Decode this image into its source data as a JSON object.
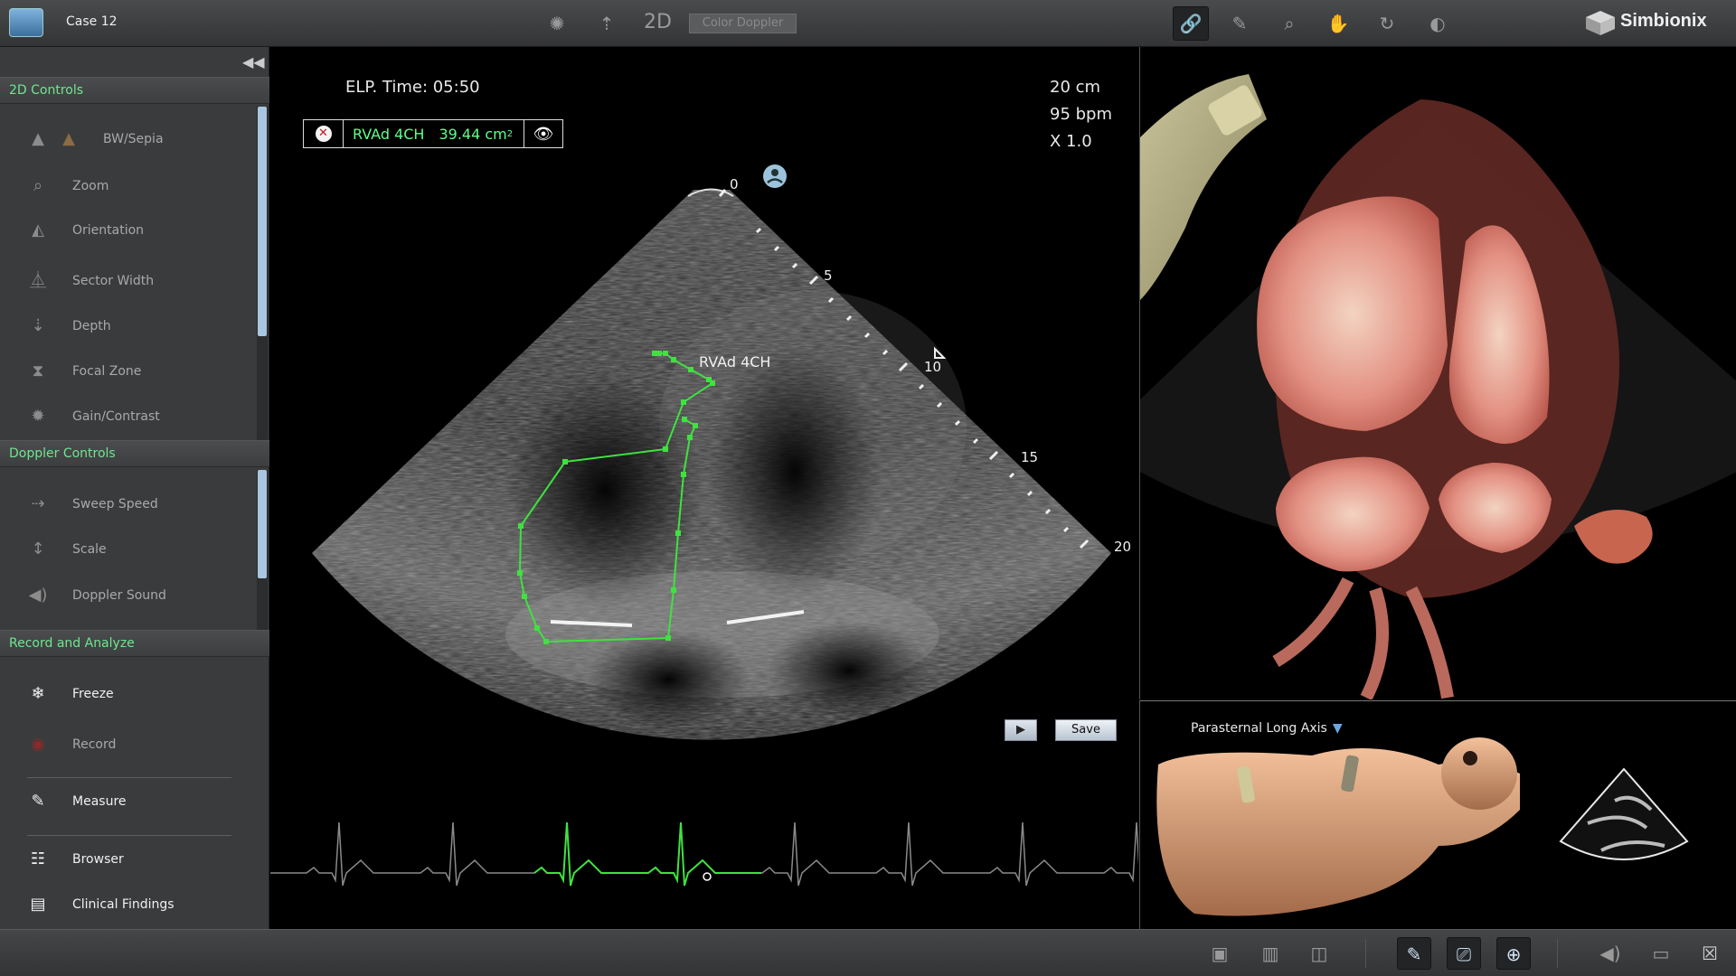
{
  "topbar": {
    "case_title": "Case 12",
    "mode_label": "2D",
    "color_doppler_label": "Color Doppler",
    "brand": "Simbionix",
    "icons": [
      "anatomy-icon",
      "probe-icon",
      "link-icon",
      "marker-icon",
      "zoom-icon",
      "hand-icon",
      "rotate-icon",
      "contrast-icon"
    ]
  },
  "left_panel": {
    "sections": [
      {
        "title": "2D Controls",
        "items": [
          "BW/Sepia",
          "Zoom",
          "Orientation",
          "Sector Width",
          "Depth",
          "Focal Zone",
          "Gain/Contrast"
        ]
      },
      {
        "title": "Doppler Controls",
        "items": [
          "Sweep Speed",
          "Scale",
          "Doppler Sound"
        ]
      },
      {
        "title": "Record and Analyze",
        "items": [
          "Freeze",
          "Record",
          "Measure",
          "Browser",
          "Clinical Findings"
        ]
      }
    ]
  },
  "main_view": {
    "elp_time": "ELP. Time: 05:50",
    "depth": "20 cm",
    "heart_rate": "95 bpm",
    "zoom": "X 1.0",
    "measurement": {
      "name": "RVAd 4CH",
      "value": "39.44 cm",
      "unit_sup": "2"
    },
    "trace_label": "RVAd 4CH",
    "depth_scale": [
      "0",
      "5",
      "10",
      "15",
      "20"
    ],
    "save_label": "Save",
    "trace_color": "#3fe23f"
  },
  "right_panel": {
    "view_name": "Parasternal Long Axis"
  },
  "bottombar": {
    "icons": [
      "layout-single-icon",
      "layout-dual-icon",
      "layout-overlay-icon",
      "probe-view-icon",
      "camera-icon",
      "globe-icon",
      "sound-icon",
      "folder-icon",
      "close-icon"
    ]
  }
}
